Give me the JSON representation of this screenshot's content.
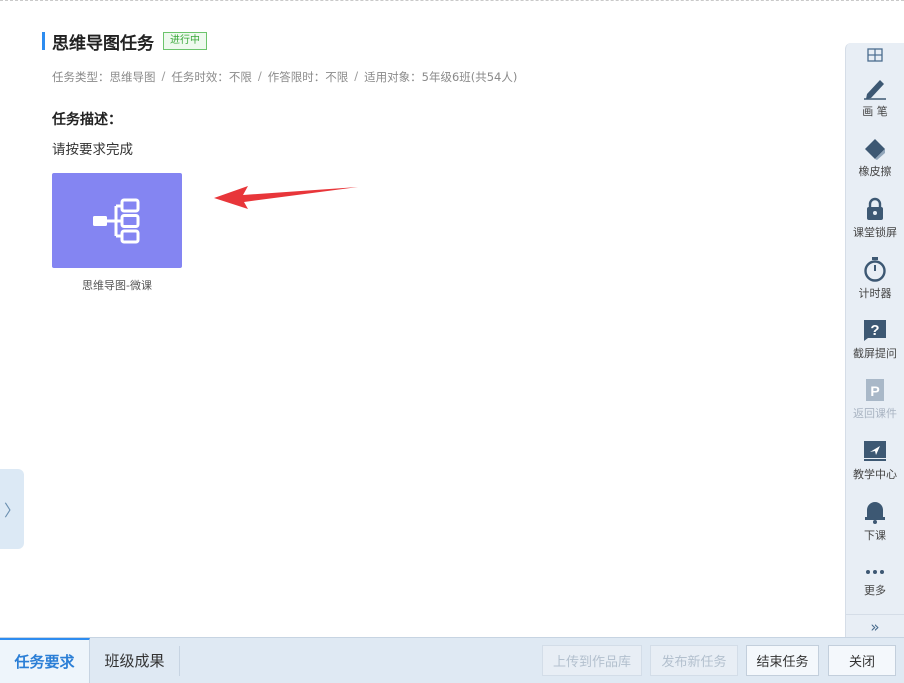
{
  "task": {
    "title": "思维导图任务",
    "status": "进行中",
    "meta": {
      "type": "任务类型：思维导图",
      "validity": "任务时效：不限",
      "time_limit": "作答限时：不限",
      "audience": "适用对象：5年级6班(共54人)",
      "separator": "/"
    },
    "description_label": "任务描述：",
    "description_text": "请按要求完成",
    "resource": {
      "label": "思维导图-微课",
      "icon": "mindmap-icon",
      "color": "#8485f2"
    }
  },
  "side_tab": {
    "glyph": "〉"
  },
  "toolbar": {
    "top_icon": "layout-icon",
    "items": [
      {
        "label": "画 笔",
        "icon": "pen-icon",
        "enabled": true
      },
      {
        "label": "橡皮擦",
        "icon": "eraser-icon",
        "enabled": true
      },
      {
        "label": "课堂锁屏",
        "icon": "lock-icon",
        "enabled": true
      },
      {
        "label": "计时器",
        "icon": "timer-icon",
        "enabled": true
      },
      {
        "label": "截屏提问",
        "icon": "question-icon",
        "enabled": true
      },
      {
        "label": "返回课件",
        "icon": "ppt-icon",
        "enabled": false
      },
      {
        "label": "教学中心",
        "icon": "send-icon",
        "enabled": true
      },
      {
        "label": "下课",
        "icon": "bell-icon",
        "enabled": true
      },
      {
        "label": "更多",
        "icon": "more-icon",
        "enabled": true
      }
    ],
    "collapse_glyph": "»"
  },
  "bottom": {
    "tabs": [
      {
        "label": "任务要求",
        "active": true
      },
      {
        "label": "班级成果",
        "active": false
      }
    ],
    "buttons": {
      "upload": "上传到作品库",
      "publish": "发布新任务",
      "end": "结束任务",
      "close": "关闭"
    }
  },
  "colors": {
    "accent": "#2d8cf0",
    "status_green": "#3aa83a",
    "arrow_red": "#e8363a"
  }
}
